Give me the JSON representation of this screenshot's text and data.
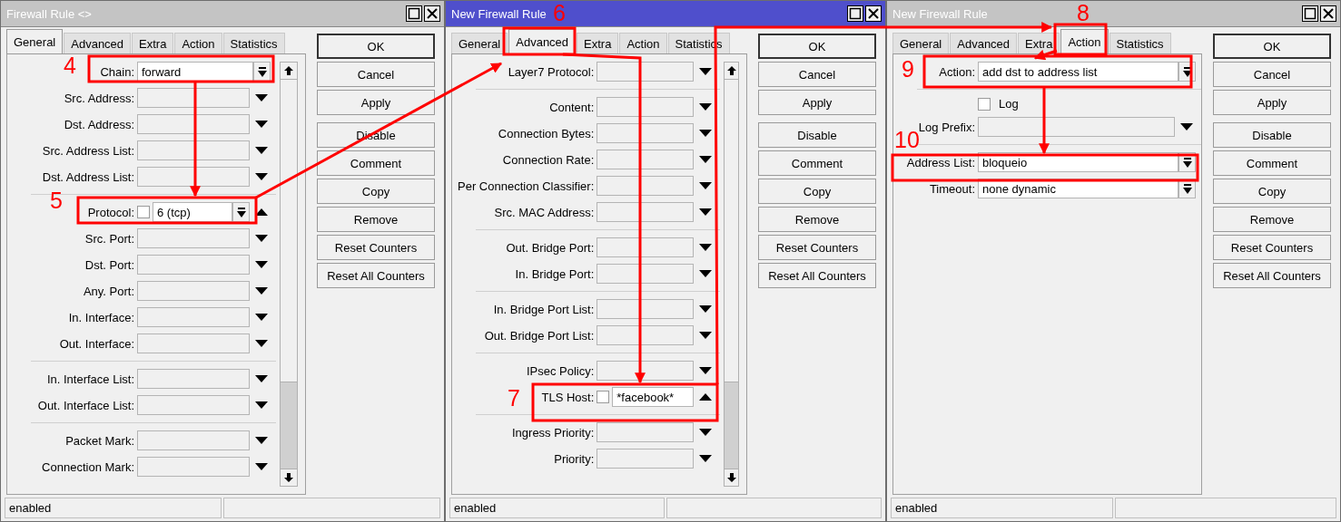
{
  "windows": [
    {
      "title": "Firewall Rule <>",
      "active": false,
      "scrollable": true,
      "tabs": [
        {
          "label": "General",
          "selected": true
        },
        {
          "label": "Advanced",
          "selected": false
        },
        {
          "label": "Extra",
          "selected": false
        },
        {
          "label": "Action",
          "selected": false
        },
        {
          "label": "Statistics",
          "selected": false
        }
      ],
      "fields": [
        {
          "kind": "select",
          "label": "Chain:",
          "value": "forward"
        },
        {
          "kind": "dropdown",
          "label": "Src. Address:"
        },
        {
          "kind": "dropdown",
          "label": "Dst. Address:"
        },
        {
          "kind": "dropdown",
          "label": "Src. Address List:"
        },
        {
          "kind": "dropdown",
          "label": "Dst. Address List:"
        },
        {
          "kind": "divider"
        },
        {
          "kind": "negselect",
          "label": "Protocol:",
          "value": "6 (tcp)",
          "checked": false
        },
        {
          "kind": "dropdown",
          "label": "Src. Port:"
        },
        {
          "kind": "dropdown",
          "label": "Dst. Port:"
        },
        {
          "kind": "dropdown",
          "label": "Any. Port:"
        },
        {
          "kind": "dropdown",
          "label": "In. Interface:"
        },
        {
          "kind": "dropdown",
          "label": "Out. Interface:"
        },
        {
          "kind": "divider"
        },
        {
          "kind": "dropdown",
          "label": "In. Interface List:"
        },
        {
          "kind": "dropdown",
          "label": "Out. Interface List:"
        },
        {
          "kind": "divider"
        },
        {
          "kind": "dropdown",
          "label": "Packet Mark:"
        },
        {
          "kind": "dropdown",
          "label": "Connection Mark:"
        }
      ],
      "button_groups": [
        [
          {
            "label": "OK",
            "default": true
          },
          {
            "label": "Cancel",
            "default": false
          },
          {
            "label": "Apply",
            "default": false
          }
        ],
        [
          {
            "label": "Disable",
            "default": false
          },
          {
            "label": "Comment",
            "default": false
          },
          {
            "label": "Copy",
            "default": false
          },
          {
            "label": "Remove",
            "default": false
          },
          {
            "label": "Reset Counters",
            "default": false
          },
          {
            "label": "Reset All Counters",
            "default": false
          }
        ]
      ],
      "status": "enabled"
    },
    {
      "title": "New Firewall Rule",
      "active": true,
      "scrollable": true,
      "tabs": [
        {
          "label": "General",
          "selected": false
        },
        {
          "label": "Advanced",
          "selected": true
        },
        {
          "label": "Extra",
          "selected": false
        },
        {
          "label": "Action",
          "selected": false
        },
        {
          "label": "Statistics",
          "selected": false
        }
      ],
      "fields": [
        {
          "kind": "dropdown",
          "label": "Layer7 Protocol:"
        },
        {
          "kind": "divider"
        },
        {
          "kind": "dropdown",
          "label": "Content:"
        },
        {
          "kind": "dropdown",
          "label": "Connection Bytes:"
        },
        {
          "kind": "dropdown",
          "label": "Connection Rate:"
        },
        {
          "kind": "dropdown",
          "label": "Per Connection Classifier:"
        },
        {
          "kind": "dropdown",
          "label": "Src. MAC Address:"
        },
        {
          "kind": "divider"
        },
        {
          "kind": "dropdown",
          "label": "Out. Bridge Port:"
        },
        {
          "kind": "dropdown",
          "label": "In. Bridge Port:"
        },
        {
          "kind": "divider"
        },
        {
          "kind": "dropdown",
          "label": "In. Bridge Port List:"
        },
        {
          "kind": "dropdown",
          "label": "Out. Bridge Port List:"
        },
        {
          "kind": "divider"
        },
        {
          "kind": "dropdown",
          "label": "IPsec Policy:"
        },
        {
          "kind": "negtext",
          "label": "TLS Host:",
          "value": "*facebook*",
          "checked": false
        },
        {
          "kind": "divider"
        },
        {
          "kind": "dropdown",
          "label": "Ingress Priority:"
        },
        {
          "kind": "dropdown",
          "label": "Priority:"
        }
      ],
      "button_groups": [
        [
          {
            "label": "OK",
            "default": true
          },
          {
            "label": "Cancel",
            "default": false
          },
          {
            "label": "Apply",
            "default": false
          }
        ],
        [
          {
            "label": "Disable",
            "default": false
          },
          {
            "label": "Comment",
            "default": false
          },
          {
            "label": "Copy",
            "default": false
          },
          {
            "label": "Remove",
            "default": false
          },
          {
            "label": "Reset Counters",
            "default": false
          },
          {
            "label": "Reset All Counters",
            "default": false
          }
        ]
      ],
      "status": "enabled"
    },
    {
      "title": "New Firewall Rule",
      "active": false,
      "scrollable": false,
      "tabs": [
        {
          "label": "General",
          "selected": false
        },
        {
          "label": "Advanced",
          "selected": false
        },
        {
          "label": "Extra",
          "selected": false
        },
        {
          "label": "Action",
          "selected": true
        },
        {
          "label": "Statistics",
          "selected": false
        }
      ],
      "fields": [
        {
          "kind": "select",
          "label": "Action:",
          "value": "add dst to address list"
        },
        {
          "kind": "divider"
        },
        {
          "kind": "checkbox",
          "label": "Log",
          "checked": false
        },
        {
          "kind": "dropdown",
          "label": "Log Prefix:"
        },
        {
          "kind": "divider"
        },
        {
          "kind": "select",
          "label": "Address List:",
          "value": "bloqueio"
        },
        {
          "kind": "select",
          "label": "Timeout:",
          "value": "none dynamic"
        }
      ],
      "button_groups": [
        [
          {
            "label": "OK",
            "default": true
          },
          {
            "label": "Cancel",
            "default": false
          },
          {
            "label": "Apply",
            "default": false
          }
        ],
        [
          {
            "label": "Disable",
            "default": false
          },
          {
            "label": "Comment",
            "default": false
          },
          {
            "label": "Copy",
            "default": false
          },
          {
            "label": "Remove",
            "default": false
          },
          {
            "label": "Reset Counters",
            "default": false
          },
          {
            "label": "Reset All Counters",
            "default": false
          }
        ]
      ],
      "status": "enabled"
    }
  ],
  "annotations": [
    {
      "label": "4"
    },
    {
      "label": "5"
    },
    {
      "label": "6"
    },
    {
      "label": "7"
    },
    {
      "label": "8"
    },
    {
      "label": "9"
    },
    {
      "label": "10"
    }
  ]
}
